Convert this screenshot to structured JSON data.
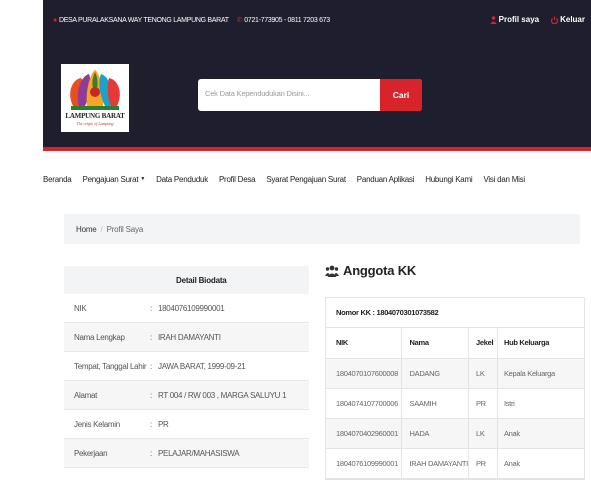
{
  "topbar": {
    "address": "DESA PURALAKSANA WAY TENONG LAMPUNG BARAT",
    "phone": "0721-773905 - 0811 7203 673",
    "profile_link": "Profil saya",
    "logout_link": "Keluar",
    "accent_color": "#d8232a"
  },
  "logo": {
    "title": "LAMPUNG BARAT",
    "subtitle": "The origin of Lampung"
  },
  "search": {
    "placeholder": "Cek Data Kependudukan Disini...",
    "button_label": "Cari"
  },
  "nav": {
    "items": [
      "Beranda",
      "Pengajuan Surat",
      "Data Penduduk",
      "Profil Desa",
      "Syarat Pengajuan Surat",
      "Panduan Aplikasi",
      "Hubungi Kami",
      "Visi dan Misi"
    ]
  },
  "breadcrumb": {
    "home": "Home",
    "separator": "/",
    "current": "Profil Saya"
  },
  "biodata": {
    "heading": "Detail Biodata",
    "rows": [
      {
        "label": "NIK",
        "value": "1804076109990001"
      },
      {
        "label": "Nama Lengkap",
        "value": "IRAH DAMAYANTI"
      },
      {
        "label": "Tempat, Tanggal Lahir",
        "value": "JAWA BARAT, 1999-09-21"
      },
      {
        "label": "Alamat",
        "value": "RT 004 / RW 003 , MARGA SALUYU 1"
      },
      {
        "label": "Jenis Kelamin",
        "value": "PR"
      },
      {
        "label": "Pekerjaan",
        "value": "PELAJAR/MAHASISWA"
      }
    ]
  },
  "anggota_kk": {
    "title": "Anggota KK",
    "nomor_kk": "Nomor KK : 1804070301073582",
    "columns": [
      "NIK",
      "Nama",
      "Jekel",
      "Hub Keluarga"
    ],
    "rows": [
      [
        "1804070107600008",
        "DADANG",
        "LK",
        "Kepala Keluarga"
      ],
      [
        "1804074107700006",
        "SAAMIH",
        "PR",
        "Istri"
      ],
      [
        "1804070402960001",
        "HADA",
        "LK",
        "Anak"
      ],
      [
        "1804076109990001",
        "IRAH DAMAYANTI",
        "PR",
        "Anak"
      ]
    ]
  }
}
